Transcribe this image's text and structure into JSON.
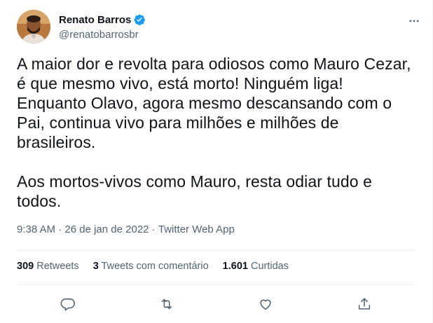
{
  "author": {
    "name": "Renato Barros",
    "handle": "@renatobarrosbr",
    "verified_color": "#1d9bf0"
  },
  "icons": {
    "more": "more-horizontal-icon",
    "verified": "verified-badge-icon",
    "reply": "reply-icon",
    "retweet": "retweet-icon",
    "like": "like-icon",
    "share": "share-icon"
  },
  "tweet": {
    "text": "A maior dor e revolta para odiosos como Mauro Cezar,\né que mesmo vivo, está morto! Ninguém liga!\nEnquanto Olavo, agora mesmo descansando com o\nPai, continua vivo para milhões e milhões de\nbrasileiros.\n\nAos mortos-vivos como Mauro, resta odiar tudo e\ntodos.",
    "time": "9:38 AM",
    "separator": " · ",
    "date": "26 de jan de 2022",
    "source": "Twitter Web App"
  },
  "stats": {
    "retweets_count": "309",
    "retweets_label": "Retweets",
    "quotes_count": "3",
    "quotes_label": "Tweets com comentário",
    "likes_count": "1.601",
    "likes_label": "Curtidas"
  }
}
